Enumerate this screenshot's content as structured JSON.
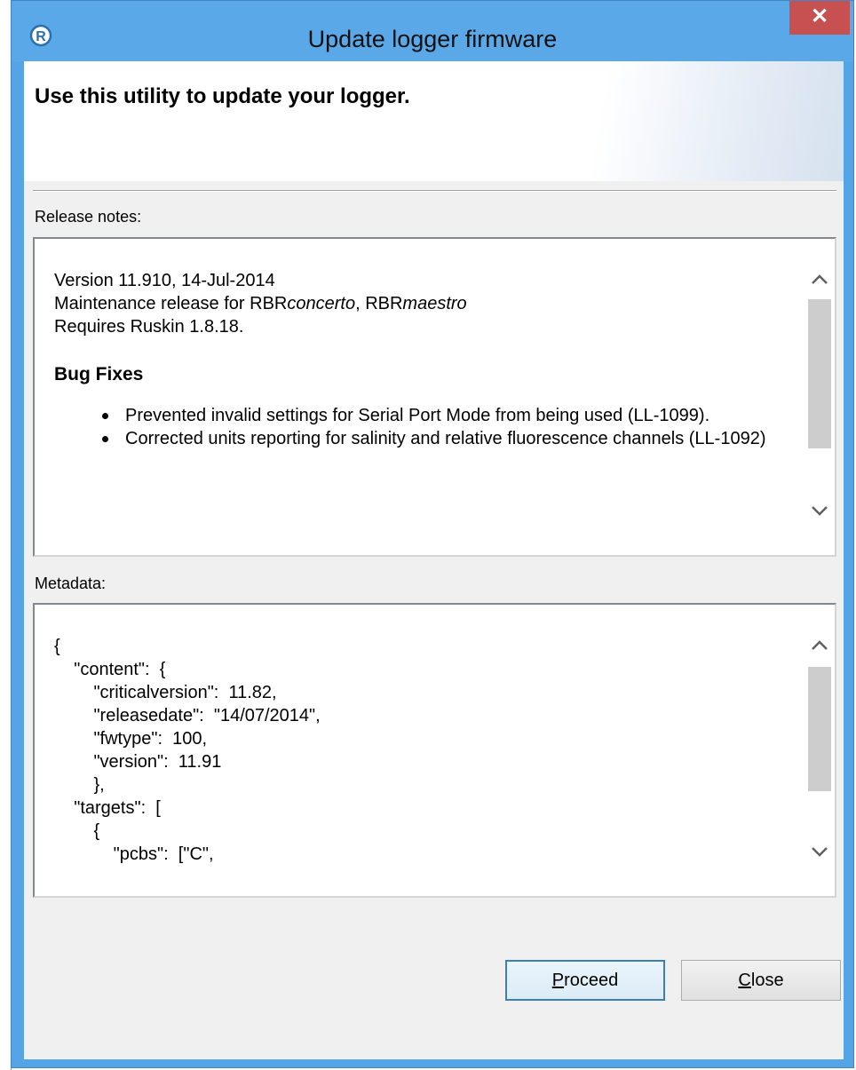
{
  "window": {
    "title": "Update logger firmware",
    "close_glyph": "✕",
    "app_icon": "r-logo-icon"
  },
  "header": {
    "text": "Use this utility to update your logger."
  },
  "release_notes": {
    "label": "Release notes:",
    "version_line": "Version 11.910, 14-Jul-2014",
    "maintenance_prefix": "Maintenance release for RBR",
    "product_1": "concerto",
    "separator": ", RBR",
    "product_2": "maestro",
    "requires_line": "Requires Ruskin 1.8.18.",
    "heading": "Bug Fixes",
    "bullets": [
      "Prevented invalid settings for Serial Port Mode from being used (LL-1099).",
      "Corrected units reporting for salinity and relative fluorescence channels (LL-1092)"
    ]
  },
  "metadata": {
    "label": "Metadata:",
    "lines": [
      "{",
      "    \"content\":  {",
      "        \"criticalversion\":  11.82,",
      "        \"releasedate\":  \"14/07/2014\",",
      "        \"fwtype\":  100,",
      "        \"version\":  11.91",
      "        },",
      "    \"targets\":  [",
      "        {",
      "            \"pcbs\":  [\"C\","
    ]
  },
  "buttons": {
    "proceed_mnemonic": "P",
    "proceed_rest": "roceed",
    "close_mnemonic": "C",
    "close_rest": "lose"
  },
  "colors": {
    "titlebar": "#5ba8e8",
    "close_button": "#c75050",
    "dialog_background": "#f0f0f0"
  }
}
